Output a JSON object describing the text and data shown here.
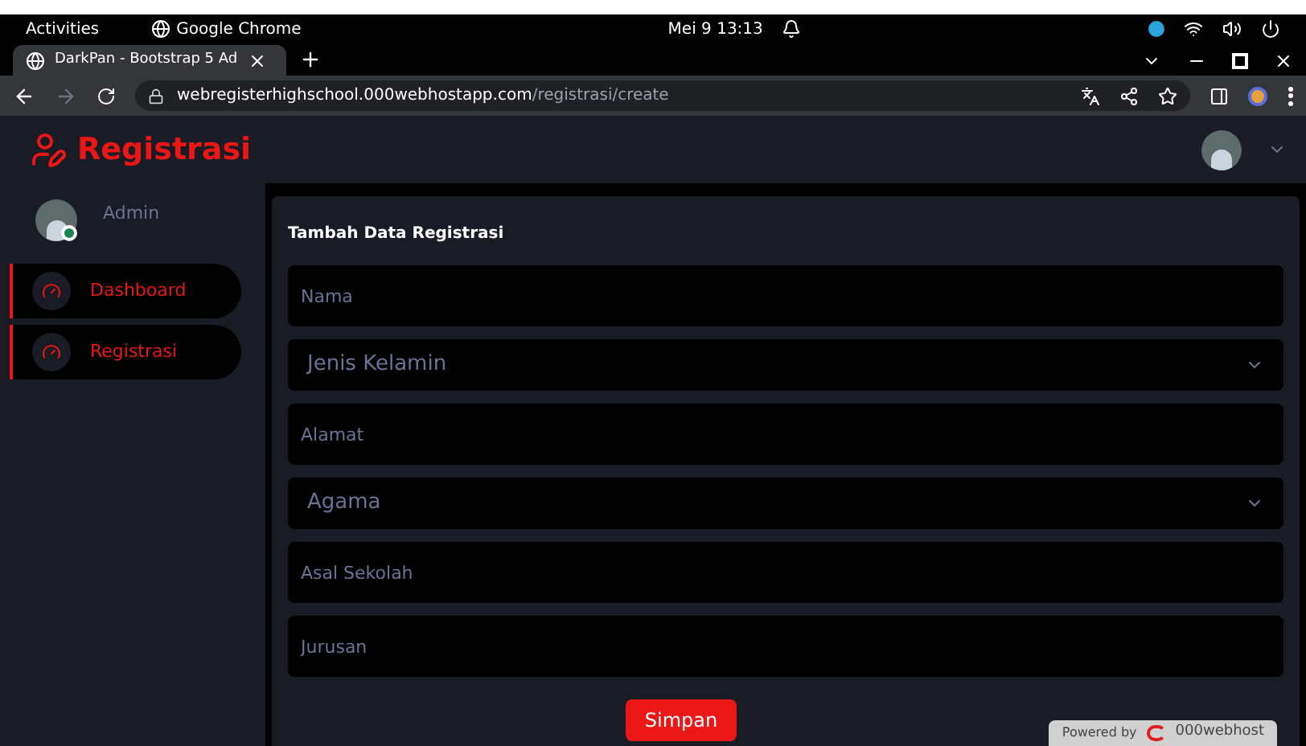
{
  "system_bar": {
    "activities": "Activities",
    "app": "Google Chrome",
    "clock": "Mei 9  13:13"
  },
  "browser": {
    "tab_title": "DarkPan - Bootstrap 5 Ad",
    "url_host": "webregisterhighschool.000webhostapp.com",
    "url_path": "/registrasi/create"
  },
  "brand": "Registrasi",
  "user": {
    "name": "Admin",
    "online": true
  },
  "sidebar": {
    "items": [
      {
        "label": "Dashboard"
      },
      {
        "label": "Registrasi"
      }
    ]
  },
  "form": {
    "title": "Tambah Data Registrasi",
    "fields": [
      {
        "kind": "input",
        "placeholder": "Nama"
      },
      {
        "kind": "select",
        "value": "Jenis Kelamin"
      },
      {
        "kind": "input",
        "placeholder": "Alamat"
      },
      {
        "kind": "select",
        "value": "Agama"
      },
      {
        "kind": "input",
        "placeholder": "Asal Sekolah"
      },
      {
        "kind": "input",
        "placeholder": "Jurusan"
      }
    ],
    "submit": "Simpan"
  },
  "badge": {
    "prefix": "Powered by",
    "brand": "000webhost"
  }
}
